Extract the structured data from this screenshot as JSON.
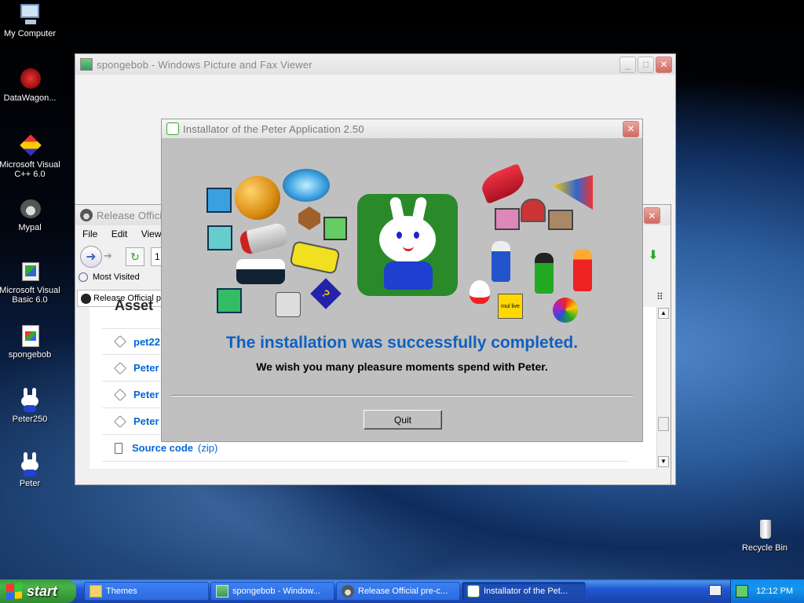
{
  "desktop": {
    "icons": [
      {
        "label": "My Computer"
      },
      {
        "label": "DataWagon..."
      },
      {
        "label": "Microsoft Visual C++ 6.0"
      },
      {
        "label": "Mypal"
      },
      {
        "label": "Microsoft Visual Basic 6.0"
      },
      {
        "label": "spongebob"
      },
      {
        "label": "Peter250"
      },
      {
        "label": "Peter"
      },
      {
        "label": "Recycle Bin"
      }
    ]
  },
  "picture_viewer": {
    "title": "spongebob - Windows Picture and Fax Viewer"
  },
  "browser": {
    "title": "Release Official",
    "menu": [
      "File",
      "Edit",
      "View"
    ],
    "bookmark": "Most Visited",
    "tab_label": "Release Official pr",
    "address_fragment": "1",
    "heading_fragment": "Asset",
    "rows": [
      {
        "label": "pet22"
      },
      {
        "label": "Peter"
      },
      {
        "label": "Peter"
      },
      {
        "label": "Peter"
      }
    ],
    "source_code": {
      "label": "Source code",
      "suffix": "(zip)"
    }
  },
  "installer": {
    "title": "Installator of the Peter Application 2.50",
    "success_message": "The installation was successfully completed.",
    "wish_message": "We wish you many pleasure moments spend with Peter.",
    "quit_label": "Quit",
    "sticker_text": "mul live"
  },
  "taskbar": {
    "start_label": "start",
    "tasks": [
      {
        "label": "Themes"
      },
      {
        "label": "spongebob - Window..."
      },
      {
        "label": "Release Official pre-c..."
      },
      {
        "label": "Installator of the Pet..."
      }
    ],
    "clock": "12:12 PM"
  },
  "colors": {
    "taskbar_blue": "#2157d7",
    "start_green": "#3c9a3c",
    "success_blue": "#1060c0",
    "link_blue": "#0366d6"
  }
}
